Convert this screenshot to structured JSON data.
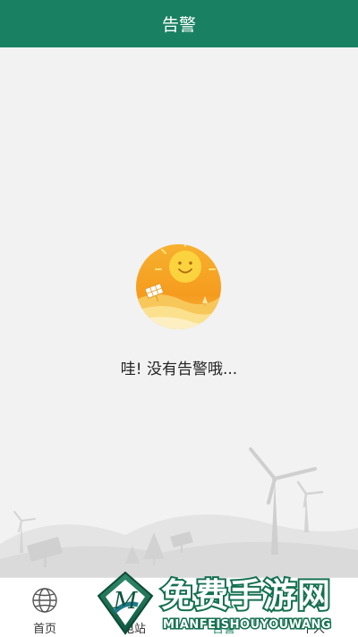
{
  "header": {
    "title": "告警"
  },
  "empty_state": {
    "message": "哇! 没有告警哦..."
  },
  "tabs": [
    {
      "label": "首页",
      "icon": "globe-icon"
    },
    {
      "label": "电站",
      "icon": "station-icon"
    },
    {
      "label": "告警",
      "icon": "alarm-icon",
      "active": true
    },
    {
      "label": "个人",
      "icon": "person-icon"
    }
  ],
  "watermark": {
    "title": "免费手游网",
    "subtitle": "MIANFEISHOUYOUWANG",
    "logo_letter": "M"
  },
  "colors": {
    "brand": "#1a8062",
    "background": "#f2f2f2",
    "sun": "#f5a623"
  }
}
